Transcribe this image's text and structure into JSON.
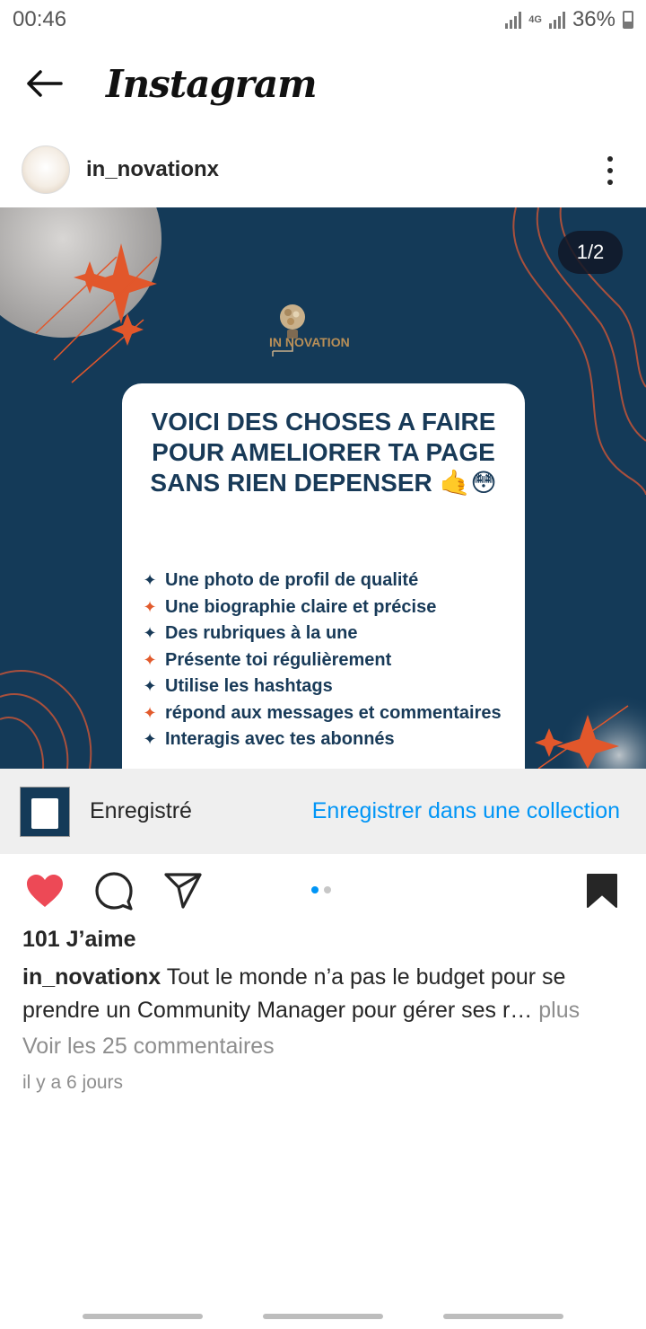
{
  "status_bar": {
    "time": "00:46",
    "network": "4G",
    "battery": "36%"
  },
  "header": {
    "title": "Instagram",
    "back_icon": "arrow-left-icon"
  },
  "post": {
    "username": "in_novationx",
    "avatar_text": "IN NOVATION",
    "counter": "1/2",
    "brand_text": "IN NOVATION",
    "card_title": "VOICI DES CHOSES A FAIRE POUR AMELIORER TA PAGE SANS RIEN DEPENSER",
    "card_emoji": "🤙😳",
    "card_items": [
      {
        "text": "Une photo de profil de qualité",
        "star": "dark"
      },
      {
        "text": "Une biographie claire et précise",
        "star": "orange"
      },
      {
        "text": "Des rubriques à la une",
        "star": "dark"
      },
      {
        "text": "Présente toi régulièrement",
        "star": "orange"
      },
      {
        "text": "Utilise les hashtags",
        "star": "dark"
      },
      {
        "text": "répond aux messages et commentaires",
        "star": "orange"
      },
      {
        "text": "Interagis avec tes abonnés",
        "star": "dark"
      }
    ],
    "colors": {
      "image_bg": "#143a58",
      "accent": "#e25b2d",
      "card_text": "#183a58"
    }
  },
  "saved_bar": {
    "label": "Enregistré",
    "action": "Enregistrer dans une collection"
  },
  "actions": {
    "like_icon": "heart-filled-icon",
    "comment_icon": "comment-icon",
    "share_icon": "send-icon",
    "save_icon": "bookmark-filled-icon",
    "carousel_active": 1,
    "carousel_total": 2
  },
  "likes": "101 J’aime",
  "caption": {
    "user": "in_novationx",
    "text": "Tout le monde n’a pas le budget pour se prendre un Community  Manager pour gérer ses r…",
    "more": "plus"
  },
  "comments_link": "Voir les 25 commentaires",
  "time_ago": "il y a 6 jours"
}
